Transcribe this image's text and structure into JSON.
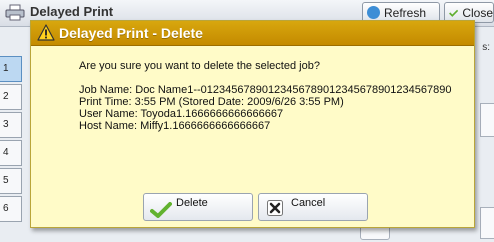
{
  "background": {
    "title": "Delayed Print",
    "refresh_label": "Refresh",
    "close_label": "Close",
    "side_rows": [
      "1",
      "2",
      "3",
      "4",
      "5",
      "6"
    ],
    "right_label": "s:"
  },
  "dialog": {
    "title": "Delayed Print - Delete",
    "question": "Are you sure you want to delete the selected job?",
    "job_name": "Job Name: Doc Name1--01234567890123456789012345678901234567890",
    "print_time": "Print Time: 3:55 PM (Stored Date: 2009/6/26 3:55 PM)",
    "user_name": "User Name: Toyoda1.1666666666666667",
    "host_name": "Host Name: Miffy1.1666666666666667",
    "delete_label": "Delete",
    "cancel_label": "Cancel"
  },
  "colors": {
    "dialog_background": "#fffbc8",
    "dialog_titlebar": "#c99200",
    "selected_row": "#bcd8f2"
  }
}
